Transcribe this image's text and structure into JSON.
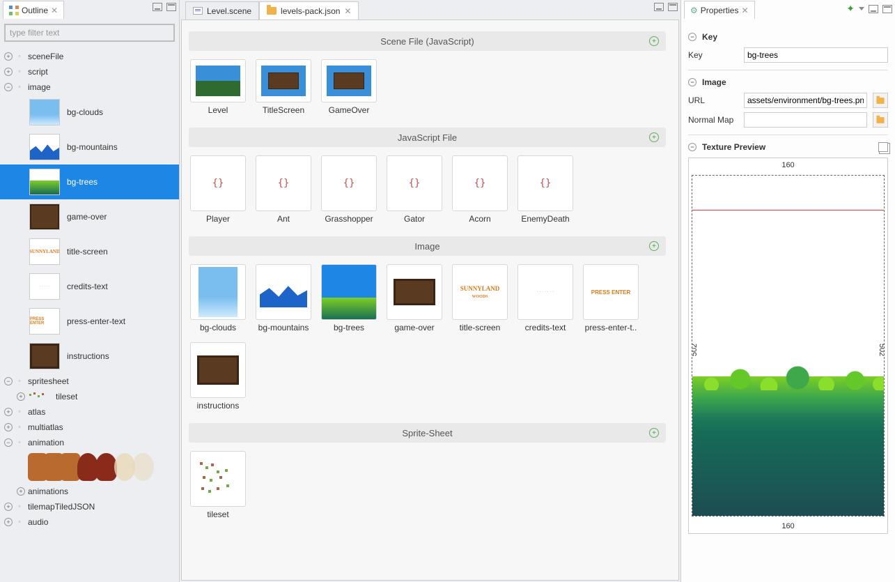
{
  "outline": {
    "title": "Outline",
    "filter_placeholder": "type filter text",
    "nodes": {
      "sceneFile": "sceneFile",
      "script": "script",
      "image": "image",
      "spritesheet": "spritesheet",
      "tileset": "tileset",
      "atlas": "atlas",
      "multiatlas": "multiatlas",
      "animation": "animation",
      "animations": "animations",
      "tilemapTiledJSON": "tilemapTiledJSON",
      "audio": "audio"
    },
    "images": [
      "bg-clouds",
      "bg-mountains",
      "bg-trees",
      "game-over",
      "title-screen",
      "credits-text",
      "press-enter-text",
      "instructions"
    ],
    "selected_image_index": 2
  },
  "editor": {
    "tabs": [
      {
        "label": "Level.scene",
        "active": false,
        "icon": "scene"
      },
      {
        "label": "levels-pack.json",
        "active": true,
        "icon": "folder"
      }
    ],
    "sections": {
      "sceneFile": {
        "title": "Scene File (JavaScript)",
        "items": [
          "Level",
          "TitleScreen",
          "GameOver"
        ]
      },
      "jsFile": {
        "title": "JavaScript File",
        "items": [
          "Player",
          "Ant",
          "Grasshopper",
          "Gator",
          "Acorn",
          "EnemyDeath"
        ]
      },
      "image": {
        "title": "Image",
        "items": [
          "bg-clouds",
          "bg-mountains",
          "bg-trees",
          "game-over",
          "title-screen",
          "credits-text",
          "press-enter-t..",
          "instructions"
        ],
        "selected_index": 2
      },
      "spriteSheet": {
        "title": "Sprite-Sheet",
        "items": [
          "tileset"
        ]
      }
    }
  },
  "properties": {
    "title": "Properties",
    "sections": {
      "key": {
        "title": "Key",
        "label": "Key",
        "value": "bg-trees"
      },
      "image": {
        "title": "Image",
        "url_label": "URL",
        "url_value": "assets/environment/bg-trees.pn",
        "normal_label": "Normal Map",
        "normal_value": ""
      },
      "preview": {
        "title": "Texture Preview",
        "width": "160",
        "height": "160",
        "left": "502",
        "right": "502"
      }
    }
  }
}
